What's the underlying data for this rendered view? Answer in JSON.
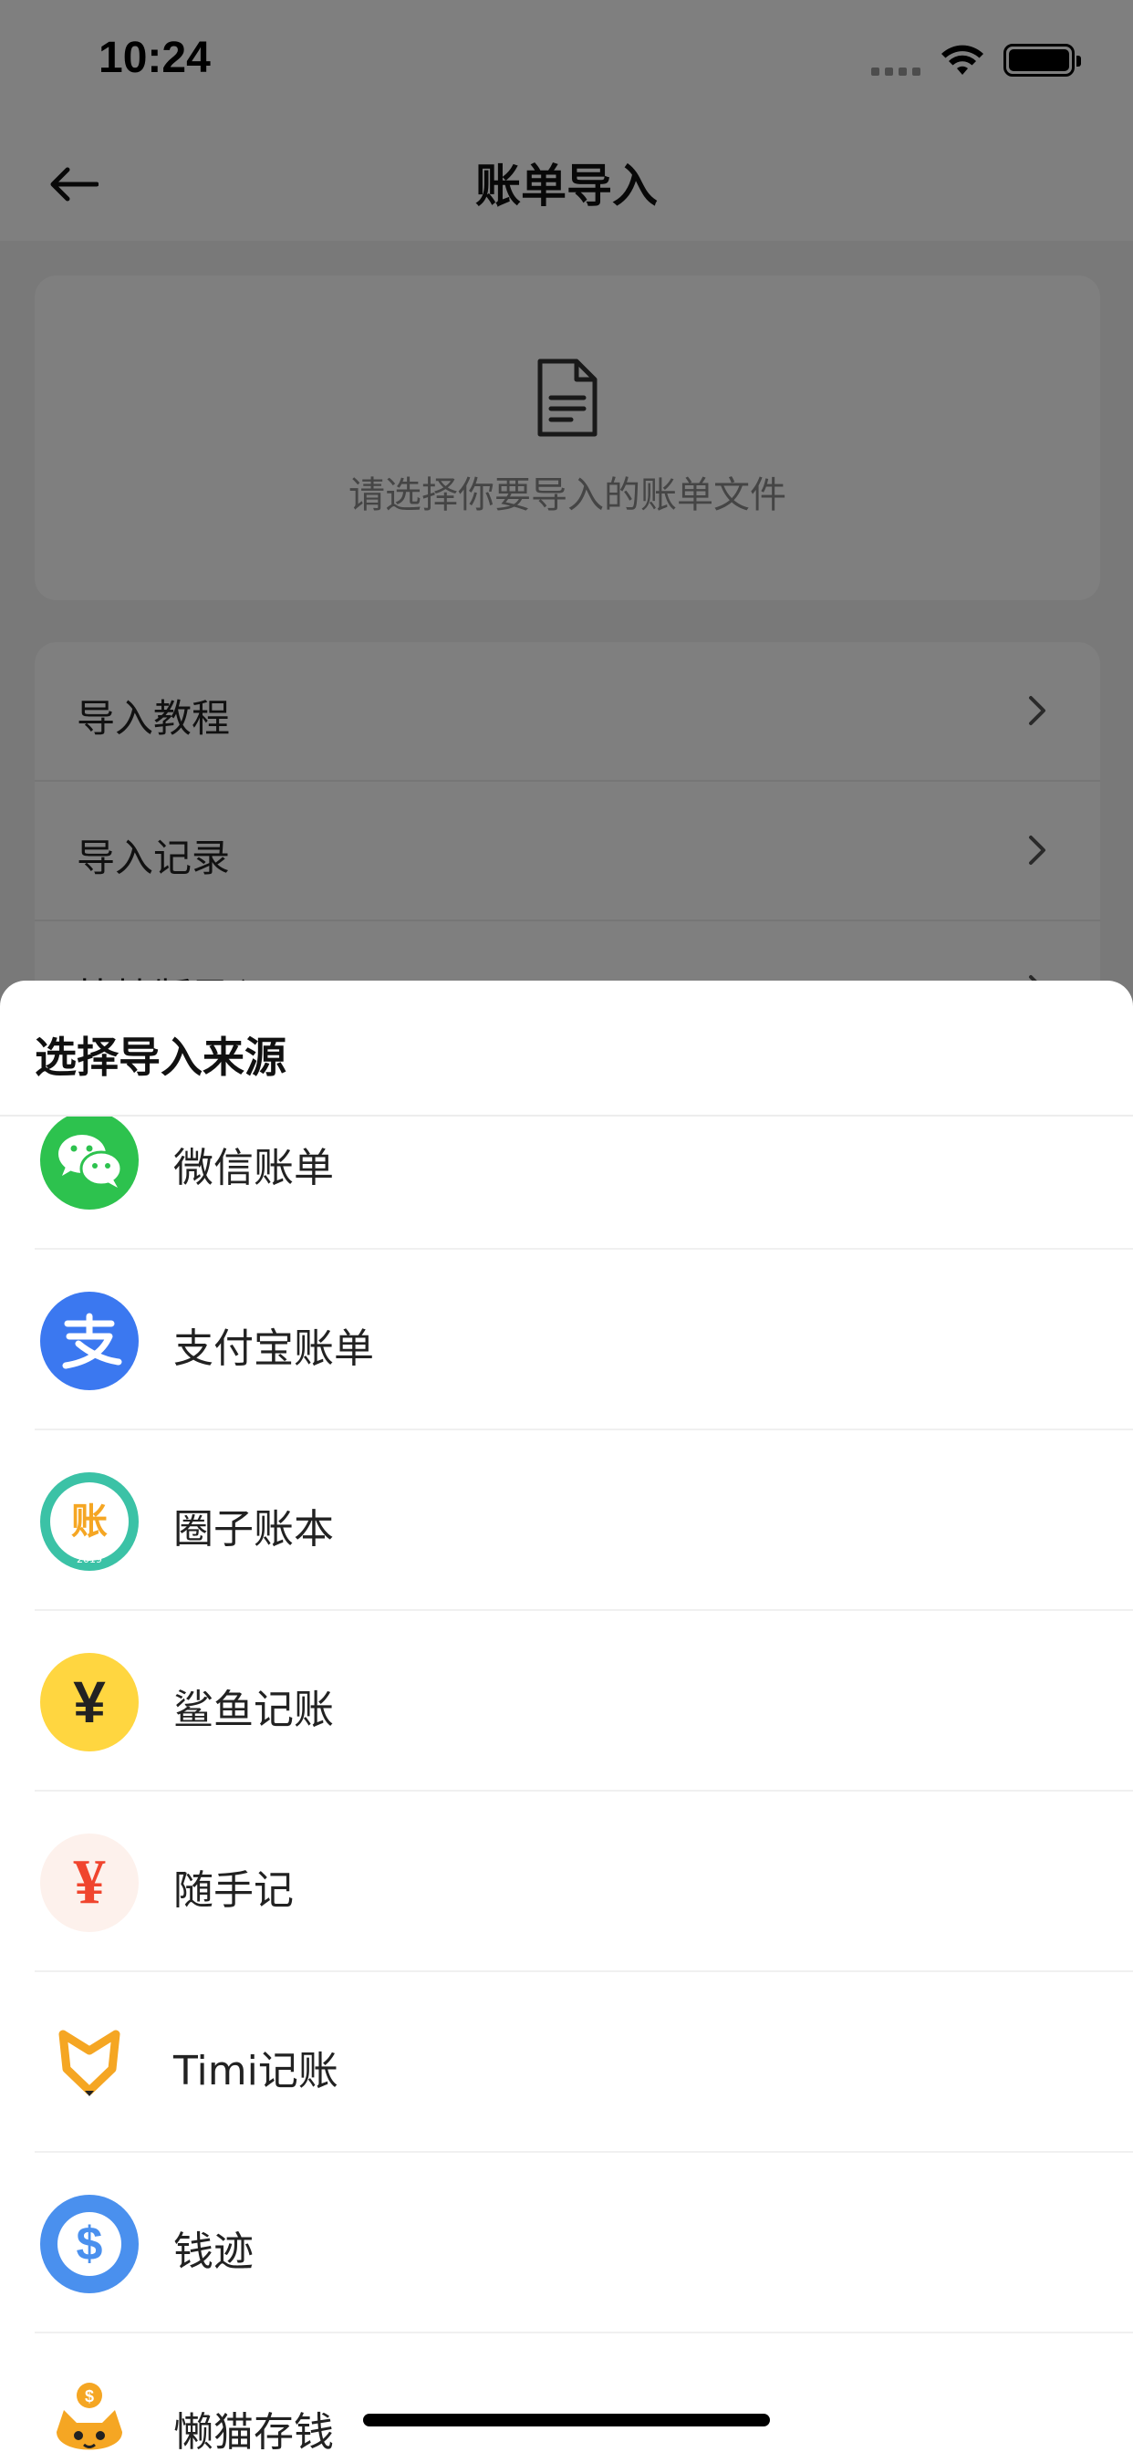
{
  "status_bar": {
    "time": "10:24"
  },
  "nav": {
    "title": "账单导入"
  },
  "file_card": {
    "hint": "请选择你要导入的账单文件"
  },
  "menu": {
    "items": [
      {
        "label": "导入教程"
      },
      {
        "label": "导入记录"
      },
      {
        "label": "快捷版导入"
      }
    ]
  },
  "sheet": {
    "title": "选择导入来源",
    "sources": [
      {
        "label": "微信账单",
        "icon": "wechat-icon",
        "color": "#2dc24e"
      },
      {
        "label": "支付宝账单",
        "icon": "alipay-icon",
        "color": "#3b78f0"
      },
      {
        "label": "圈子账本",
        "icon": "quanzi-icon",
        "color": "#3bc2a6",
        "glyph": "账",
        "year": "2019"
      },
      {
        "label": "鲨鱼记账",
        "icon": "shayu-icon",
        "color": "#ffd640",
        "glyph": "¥"
      },
      {
        "label": "随手记",
        "icon": "suishouji-icon",
        "color": "#f0452e",
        "glyph": "¥"
      },
      {
        "label": "Timi记账",
        "icon": "timi-icon",
        "color": "#f5a623"
      },
      {
        "label": "钱迹",
        "icon": "qianji-icon",
        "color": "#4a90ee",
        "glyph": "$"
      },
      {
        "label": "懒猫存钱",
        "icon": "lanmao-icon",
        "color": "#f5a623"
      }
    ]
  }
}
